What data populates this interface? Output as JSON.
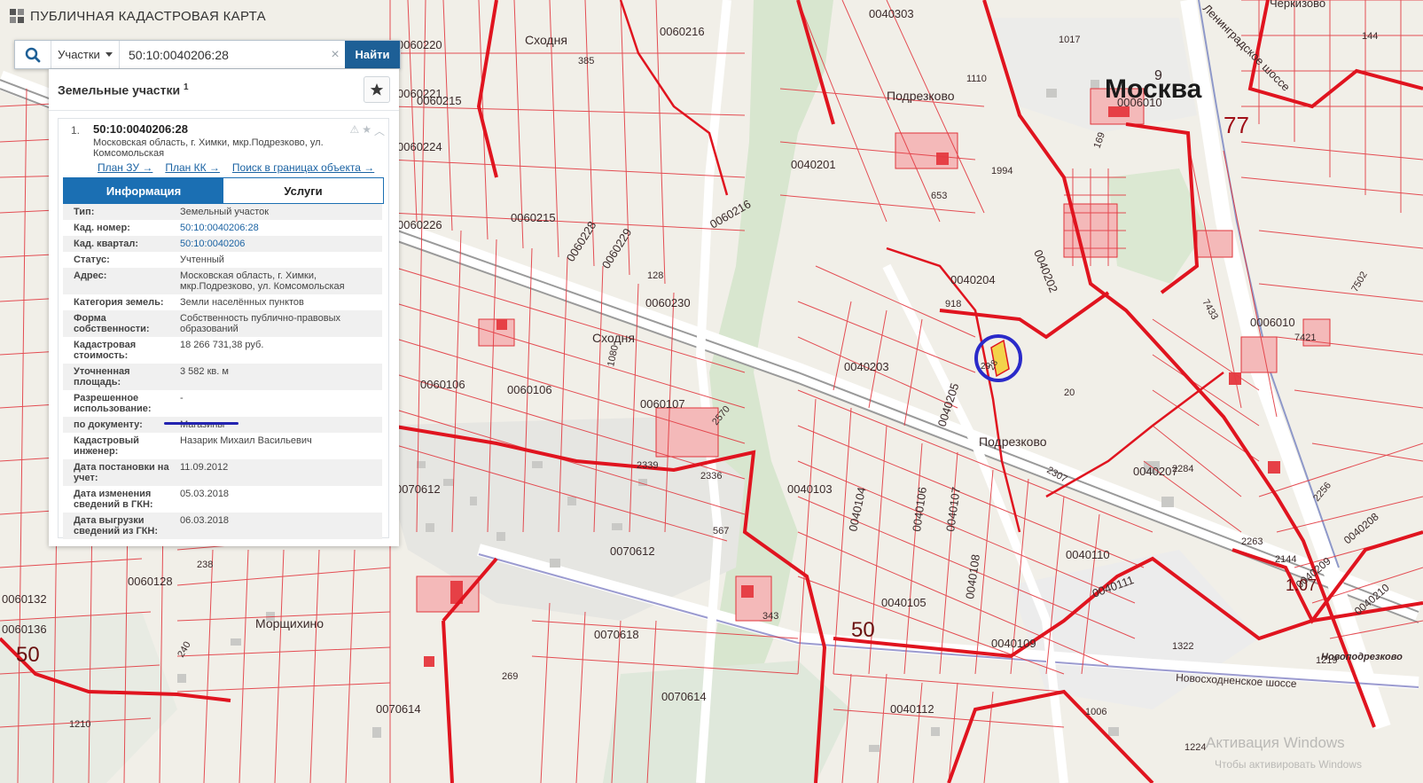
{
  "app": {
    "title": "ПУБЛИЧНАЯ КАДАСТРОВАЯ КАРТА"
  },
  "search": {
    "type_selector": "Участки",
    "query": "50:10:0040206:28",
    "find_label": "Найти"
  },
  "panel": {
    "title": "Земельные участки",
    "count": "1",
    "result": {
      "index": "1.",
      "cad_number": "50:10:0040206:28",
      "address": "Московская область, г. Химки, мкр.Подрезково, ул. Комсомольская",
      "links": [
        "План ЗУ →",
        "План КК →",
        "Поиск в границах объекта →"
      ],
      "tabs": [
        {
          "label": "Информация",
          "active": true
        },
        {
          "label": "Услуги",
          "active": false
        }
      ],
      "fields": [
        {
          "key": "Тип:",
          "value": "Земельный участок",
          "link": false
        },
        {
          "key": "Кад. номер:",
          "value": "50:10:0040206:28",
          "link": true
        },
        {
          "key": "Кад. квартал:",
          "value": "50:10:0040206",
          "link": true
        },
        {
          "key": "Статус:",
          "value": "Учтенный",
          "link": false
        },
        {
          "key": "Адрес:",
          "value": "Московская область, г. Химки, мкр.Подрезково, ул. Комсомольская",
          "link": false
        },
        {
          "key": "Категория земель:",
          "value": "Земли населённых пунктов",
          "link": false
        },
        {
          "key": "Форма собственности:",
          "value": "Собственность публично-правовых образований",
          "link": false
        },
        {
          "key": "Кадастровая стоимость:",
          "value": "18 266 731,38 руб.",
          "link": false
        },
        {
          "key": "Уточненная площадь:",
          "value": "3 582 кв. м",
          "link": false
        },
        {
          "key": "Разрешенное использование:",
          "value": "-",
          "link": false
        },
        {
          "key": "по документу:",
          "value": "Магазины",
          "link": false
        },
        {
          "key": "Кадастровый инженер:",
          "value": "Назарик Михаил Васильевич",
          "link": false
        },
        {
          "key": "Дата постановки на учет:",
          "value": "11.09.2012",
          "link": false
        },
        {
          "key": "Дата изменения сведений в ГКН:",
          "value": "05.03.2018",
          "link": false
        },
        {
          "key": "Дата выгрузки сведений из ГКН:",
          "value": "06.03.2018",
          "link": false
        }
      ]
    }
  },
  "map": {
    "labels": [
      {
        "text": "Москва",
        "kind": "city"
      },
      {
        "text": "Подрезково",
        "kind": "place"
      },
      {
        "text": "Подрезково",
        "kind": "place"
      },
      {
        "text": "Сходня",
        "kind": "place"
      },
      {
        "text": "Сходня",
        "kind": "place"
      },
      {
        "text": "Морщихино",
        "kind": "place"
      },
      {
        "text": "Черкизово",
        "kind": "place"
      },
      {
        "text": "Ленинградское шоссе",
        "kind": "road"
      },
      {
        "text": "Новосходненское шоссе",
        "kind": "road"
      },
      {
        "text": "Новоподрезково",
        "kind": "road"
      },
      {
        "text": "0040202",
        "kind": "quarter"
      },
      {
        "text": "0040201",
        "kind": "quarter"
      },
      {
        "text": "0040203",
        "kind": "quarter"
      },
      {
        "text": "0040204",
        "kind": "quarter"
      },
      {
        "text": "0040205",
        "kind": "quarter"
      },
      {
        "text": "0040207",
        "kind": "quarter"
      },
      {
        "text": "0040303",
        "kind": "quarter"
      },
      {
        "text": "0040103",
        "kind": "quarter"
      },
      {
        "text": "0040104",
        "kind": "quarter"
      },
      {
        "text": "0040105",
        "kind": "quarter"
      },
      {
        "text": "0040106",
        "kind": "quarter"
      },
      {
        "text": "0040107",
        "kind": "quarter"
      },
      {
        "text": "0040108",
        "kind": "quarter"
      },
      {
        "text": "0040109",
        "kind": "quarter"
      },
      {
        "text": "0040110",
        "kind": "quarter"
      },
      {
        "text": "0040111",
        "kind": "quarter"
      },
      {
        "text": "0040112",
        "kind": "quarter"
      },
      {
        "text": "0040208",
        "kind": "quarter"
      },
      {
        "text": "0040209",
        "kind": "quarter"
      },
      {
        "text": "0040210",
        "kind": "quarter"
      },
      {
        "text": "0060216",
        "kind": "quarter"
      },
      {
        "text": "0060216",
        "kind": "quarter"
      },
      {
        "text": "0060215",
        "kind": "quarter"
      },
      {
        "text": "0060215",
        "kind": "quarter"
      },
      {
        "text": "0060220",
        "kind": "quarter"
      },
      {
        "text": "0060221",
        "kind": "quarter"
      },
      {
        "text": "0060224",
        "kind": "quarter"
      },
      {
        "text": "0060226",
        "kind": "quarter"
      },
      {
        "text": "0060228",
        "kind": "quarter"
      },
      {
        "text": "0060229",
        "kind": "quarter"
      },
      {
        "text": "0060230",
        "kind": "quarter"
      },
      {
        "text": "0060106",
        "kind": "quarter"
      },
      {
        "text": "0060106",
        "kind": "quarter"
      },
      {
        "text": "0060107",
        "kind": "quarter"
      },
      {
        "text": "0060128",
        "kind": "quarter"
      },
      {
        "text": "0060132",
        "kind": "quarter"
      },
      {
        "text": "0060136",
        "kind": "quarter"
      },
      {
        "text": "0006010",
        "kind": "quarter"
      },
      {
        "text": "0006010",
        "kind": "quarter"
      },
      {
        "text": "0070612",
        "kind": "quarter"
      },
      {
        "text": "0070612",
        "kind": "quarter"
      },
      {
        "text": "0070618",
        "kind": "quarter"
      },
      {
        "text": "0070614",
        "kind": "quarter"
      },
      {
        "text": "0070614",
        "kind": "quarter"
      },
      {
        "text": "77",
        "kind": "region"
      },
      {
        "text": "50",
        "kind": "region"
      },
      {
        "text": "50",
        "kind": "region"
      },
      {
        "text": "1.07",
        "kind": "region"
      },
      {
        "text": "20",
        "kind": "parcel"
      },
      {
        "text": "1322",
        "kind": "parcel"
      },
      {
        "text": "1224",
        "kind": "parcel"
      },
      {
        "text": "1006",
        "kind": "parcel"
      },
      {
        "text": "567",
        "kind": "parcel"
      },
      {
        "text": "2339",
        "kind": "parcel"
      },
      {
        "text": "2336",
        "kind": "parcel"
      },
      {
        "text": "2570",
        "kind": "parcel"
      },
      {
        "text": "2307",
        "kind": "parcel"
      },
      {
        "text": "2284",
        "kind": "parcel"
      },
      {
        "text": "2256",
        "kind": "parcel"
      },
      {
        "text": "2263",
        "kind": "parcel"
      },
      {
        "text": "2144",
        "kind": "parcel"
      },
      {
        "text": "1219",
        "kind": "parcel"
      },
      {
        "text": "1210",
        "kind": "parcel"
      },
      {
        "text": "7421",
        "kind": "parcel"
      },
      {
        "text": "7433",
        "kind": "parcel"
      },
      {
        "text": "7502",
        "kind": "parcel"
      },
      {
        "text": "1017",
        "kind": "parcel"
      },
      {
        "text": "1110",
        "kind": "parcel"
      },
      {
        "text": "1994",
        "kind": "parcel"
      },
      {
        "text": "1080",
        "kind": "parcel"
      },
      {
        "text": "385",
        "kind": "parcel"
      },
      {
        "text": "343",
        "kind": "parcel"
      },
      {
        "text": "269",
        "kind": "parcel"
      },
      {
        "text": "240",
        "kind": "parcel"
      },
      {
        "text": "238",
        "kind": "parcel"
      },
      {
        "text": "128",
        "kind": "parcel"
      },
      {
        "text": "653",
        "kind": "parcel"
      },
      {
        "text": "918",
        "kind": "parcel"
      },
      {
        "text": "144",
        "kind": "parcel"
      },
      {
        "text": "169",
        "kind": "parcel"
      },
      {
        "text": "9",
        "kind": "parcel"
      },
      {
        "text": "28",
        "kind": "parcel"
      },
      {
        "text": "29",
        "kind": "parcel"
      }
    ],
    "watermark_line1": "Активация Windows",
    "watermark_line2": "Чтобы активировать Windows"
  }
}
